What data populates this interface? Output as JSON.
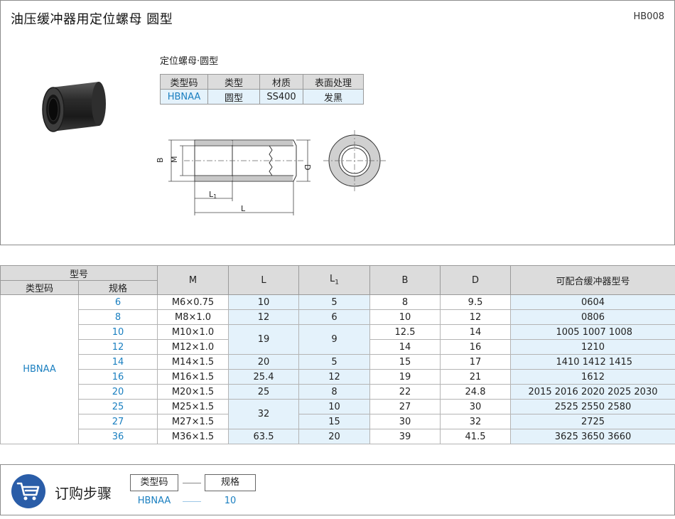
{
  "header": {
    "title": "油压缓冲器用定位螺母  圆型",
    "code": "HB008"
  },
  "spec": {
    "label": "定位螺母·圆型",
    "headers": [
      "类型码",
      "类型",
      "材质",
      "表面处理"
    ],
    "row": [
      "HBNAA",
      "圆型",
      "SS400",
      "发黑"
    ]
  },
  "drawing": {
    "labels": {
      "b": "B",
      "m": "M",
      "d": "D",
      "l1": "L",
      "l1_sub": "1",
      "l": "L"
    }
  },
  "table": {
    "header_model": "型号",
    "header_type": "类型码",
    "header_size": "规格",
    "header_m": "M",
    "header_l": "L",
    "header_l1": "L",
    "header_l1_sub": "1",
    "header_b": "B",
    "header_d": "D",
    "header_compatible": "可配合缓冲器型号",
    "type_code": "HBNAA",
    "rows": [
      {
        "size": "6",
        "m": "M6×0.75",
        "l": "10",
        "l1": "5",
        "b": "8",
        "d": "9.5",
        "compat": "0604"
      },
      {
        "size": "8",
        "m": "M8×1.0",
        "l": "12",
        "l1": "6",
        "b": "10",
        "d": "12",
        "compat": "0806"
      },
      {
        "size": "10",
        "m": "M10×1.0",
        "l": "19",
        "l1": "9",
        "b": "12.5",
        "d": "14",
        "compat": "1005  1007  1008"
      },
      {
        "size": "12",
        "m": "M12×1.0",
        "l": "",
        "l1": "",
        "b": "14",
        "d": "16",
        "compat": "1210"
      },
      {
        "size": "14",
        "m": "M14×1.5",
        "l": "20",
        "l1": "5",
        "b": "15",
        "d": "17",
        "compat": "1410  1412  1415"
      },
      {
        "size": "16",
        "m": "M16×1.5",
        "l": "25.4",
        "l1": "12",
        "b": "19",
        "d": "21",
        "compat": "1612"
      },
      {
        "size": "20",
        "m": "M20×1.5",
        "l": "25",
        "l1": "8",
        "b": "22",
        "d": "24.8",
        "compat": "2015  2016  2020  2025  2030"
      },
      {
        "size": "25",
        "m": "M25×1.5",
        "l": "32",
        "l1": "10",
        "b": "27",
        "d": "30",
        "compat": "2525  2550  2580"
      },
      {
        "size": "27",
        "m": "M27×1.5",
        "l": "",
        "l1": "15",
        "b": "30",
        "d": "32",
        "compat": "2725"
      },
      {
        "size": "36",
        "m": "M36×1.5",
        "l": "63.5",
        "l1": "20",
        "b": "39",
        "d": "41.5",
        "compat": "3625  3650  3660"
      }
    ]
  },
  "order": {
    "title": "订购步骤",
    "box1": "类型码",
    "box2": "规格",
    "val1": "HBNAA",
    "val2": "10",
    "colors": {
      "icon": "#2a5da8",
      "accent": "#1a7fc0"
    }
  }
}
